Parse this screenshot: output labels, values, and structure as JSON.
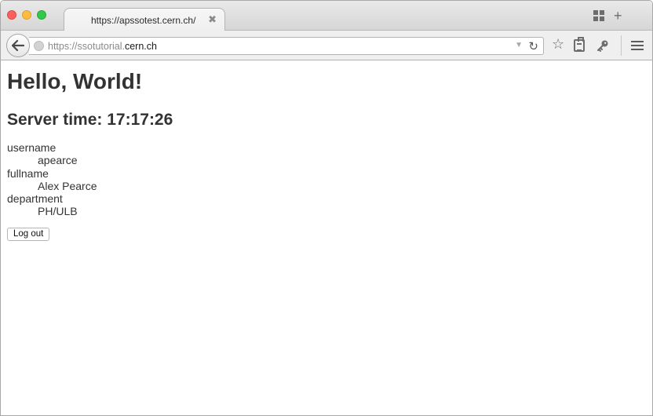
{
  "tab": {
    "title": "https://apssotest.cern.ch/"
  },
  "address_bar": {
    "url_prefix": "https://ssotutorial.",
    "url_domain": "cern.ch"
  },
  "page": {
    "title": "Hello, World!",
    "server_time": "Server time: 17:17:26",
    "fields": [
      {
        "label": "username",
        "value": "apearce"
      },
      {
        "label": "fullname",
        "value": "Alex Pearce"
      },
      {
        "label": "department",
        "value": "PH/ULB"
      }
    ],
    "logout_label": "Log out"
  },
  "icons": {
    "close": "close-icon",
    "tab_groups": "tab-groups-icon",
    "new_tab": "plus-icon",
    "back": "back-arrow-icon",
    "site_identity": "globe-icon",
    "url_history": "dropdown-arrow-icon",
    "reload": "reload-icon",
    "bookmark": "star-icon",
    "clipboard": "clipboard-icon",
    "key": "key-icon",
    "menu": "hamburger-menu-icon"
  },
  "colors": {
    "close_red": "#fc605c",
    "minimize_yellow": "#fdbc40",
    "maximize_green": "#34c84a",
    "text": "#333333"
  }
}
